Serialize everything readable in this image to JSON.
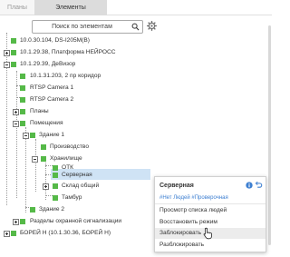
{
  "tabs": [
    {
      "label": "Планы",
      "active": false
    },
    {
      "label": "Элементы",
      "active": true
    }
  ],
  "search": {
    "placeholder": "Поиск по элементам"
  },
  "icons": {
    "search": "search-icon",
    "settings": "gear-icon",
    "expand": "plus-box-icon",
    "collapse": "minus-box-icon",
    "info": "info-icon",
    "undo": "undo-icon",
    "cursor": "hand-pointer-icon"
  },
  "tree": [
    {
      "label": "10.0.30.104, DS-I205M(B)"
    },
    {
      "label": "10.1.29.38, Платформа НЕЙРОСС"
    },
    {
      "label": "10.1.29.39, ДеВизор"
    },
    {
      "label": "10.1.31.203, 2 пр коридор"
    },
    {
      "label": "RTSP Camera 1"
    },
    {
      "label": "RTSP Camera 2"
    },
    {
      "label": "Планы"
    },
    {
      "label": "Помещения"
    },
    {
      "label": "Здание 1"
    },
    {
      "label": "Производство"
    },
    {
      "label": "Хранилище"
    },
    {
      "label": "ОТК"
    },
    {
      "label": "Серверная"
    },
    {
      "label": "Склад общий"
    },
    {
      "label": "Тамбур"
    },
    {
      "label": "Здание 2"
    },
    {
      "label": "Разделы охранной сигнализации"
    },
    {
      "label": "БОРЕЙ Н (10.1.30.36, БОРЕЙ Н)"
    }
  ],
  "context_menu": {
    "title": "Серверная",
    "tags": "#Нет Людей #Проверочная",
    "items": [
      {
        "label": "Просмотр списка людей"
      },
      {
        "label": "Восстановить режим"
      },
      {
        "label": "Заблокировать"
      },
      {
        "label": "Разблокировать"
      }
    ]
  },
  "colors": {
    "status_green": "#55b948",
    "selection": "#cfe3f5",
    "tag_blue": "#3d7fd1",
    "active_tab": "#dcdcdc"
  }
}
